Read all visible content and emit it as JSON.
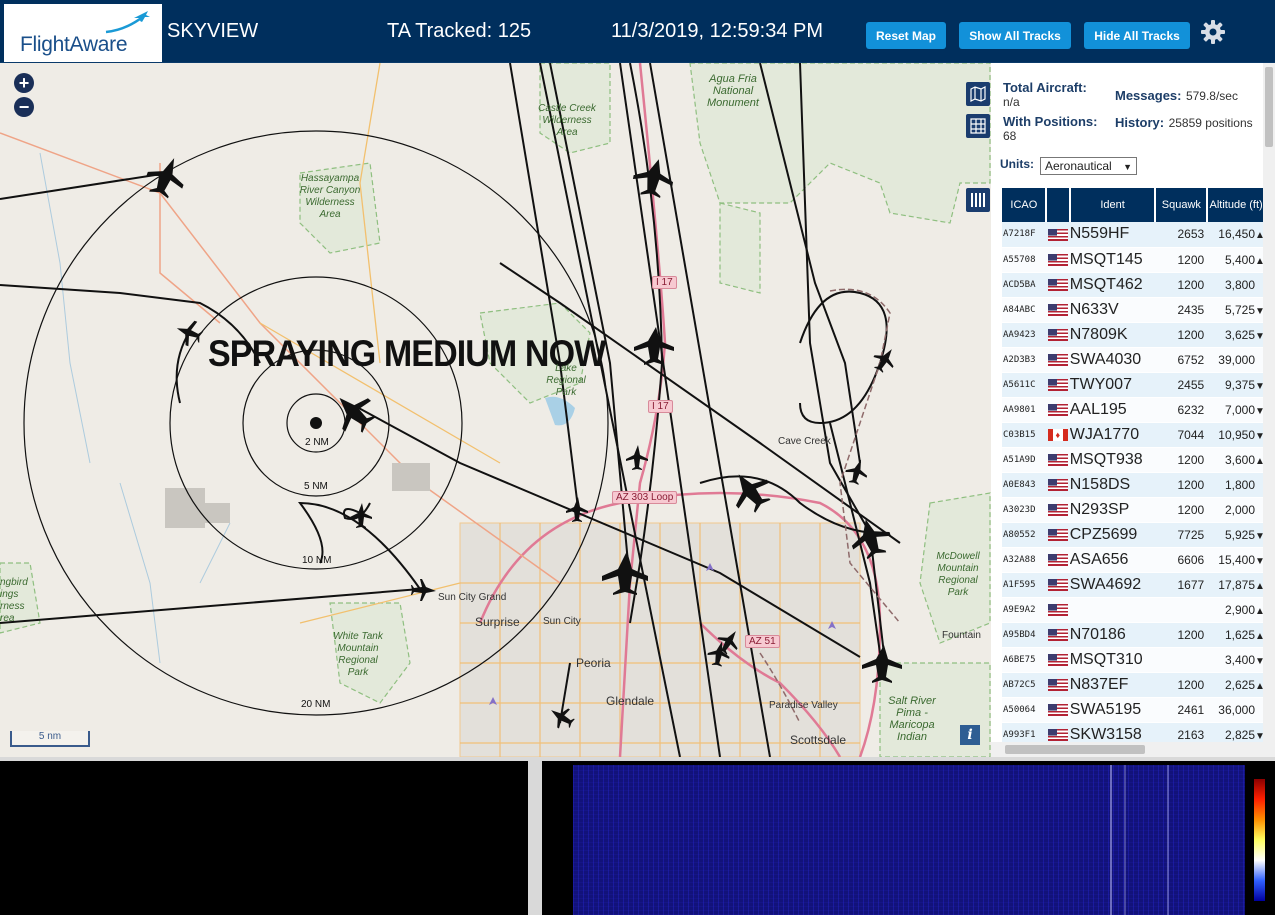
{
  "header": {
    "logo_text": "FlightAware",
    "app_title": "SKYVIEW",
    "ta_tracked": "TA Tracked: 125",
    "clock": "11/3/2019, 12:59:34 PM",
    "buttons": {
      "reset_map": "Reset Map",
      "show_all": "Show All Tracks",
      "hide_all": "Hide All Tracks"
    },
    "settings_icon": "gear-icon"
  },
  "map": {
    "overlay_text": "SPRAYING MEDIUM NOW",
    "range_labels": [
      "2 NM",
      "5 NM",
      "10 NM",
      "20 NM"
    ],
    "scale_label": "5 nm",
    "places": {
      "castle_creek": "Castle Creek Wilderness Area",
      "agua_fria": "Agua Fria National Monument",
      "hassayampa": "Hassayampa River Canyon Wilderness Area",
      "lake_regional": "Lake Regional Park",
      "cave_creek": "Cave Creek",
      "sun_city_grand": "Sun City Grand",
      "surprise": "Surprise",
      "sun_city": "Sun City",
      "peoria": "Peoria",
      "glendale": "Glendale",
      "white_tank": "White Tank Mountain Regional Park",
      "mcdowell": "McDowell Mountain Regional Park",
      "fountain": "Fountain",
      "paradise_valley": "Paradise Valley",
      "scottsdale": "Scottsdale",
      "salt_river": "Salt River Pima - Maricopa Indian",
      "hummingbird": "ngbird ings rness rea"
    },
    "road_tags": {
      "i17a": "I 17",
      "i17b": "I 17",
      "loop303": "AZ 303 Loop",
      "loop51": "AZ 51"
    }
  },
  "panel": {
    "total_aircraft_label": "Total Aircraft:",
    "total_aircraft_value": "n/a",
    "messages_label": "Messages:",
    "messages_value": "579.8/sec",
    "with_positions_label": "With Positions:",
    "with_positions_value": "68",
    "history_label": "History:",
    "history_value": "25859 positions",
    "units_label": "Units:",
    "units_value": "Aeronautical",
    "columns": [
      "ICAO",
      "",
      "Ident",
      "Squawk",
      "Altitude (ft)"
    ],
    "rows": [
      {
        "icao": "A7218F",
        "flag": "us",
        "ident": "N559HF",
        "squawk": "2653",
        "alt": "16,450",
        "trend": "▲"
      },
      {
        "icao": "A55708",
        "flag": "us",
        "ident": "MSQT145",
        "squawk": "1200",
        "alt": "5,400",
        "trend": "▲"
      },
      {
        "icao": "ACD5BA",
        "flag": "us",
        "ident": "MSQT462",
        "squawk": "1200",
        "alt": "3,800",
        "trend": ""
      },
      {
        "icao": "A84ABC",
        "flag": "us",
        "ident": "N633V",
        "squawk": "2435",
        "alt": "5,725",
        "trend": "▼"
      },
      {
        "icao": "AA9423",
        "flag": "us",
        "ident": "N7809K",
        "squawk": "1200",
        "alt": "3,625",
        "trend": "▼"
      },
      {
        "icao": "A2D3B3",
        "flag": "us",
        "ident": "SWA4030",
        "squawk": "6752",
        "alt": "39,000",
        "trend": ""
      },
      {
        "icao": "A5611C",
        "flag": "us",
        "ident": "TWY007",
        "squawk": "2455",
        "alt": "9,375",
        "trend": "▼"
      },
      {
        "icao": "AA9801",
        "flag": "us",
        "ident": "AAL195",
        "squawk": "6232",
        "alt": "7,000",
        "trend": "▼"
      },
      {
        "icao": "C03B15",
        "flag": "ca",
        "ident": "WJA1770",
        "squawk": "7044",
        "alt": "10,950",
        "trend": "▼"
      },
      {
        "icao": "A51A9D",
        "flag": "us",
        "ident": "MSQT938",
        "squawk": "1200",
        "alt": "3,600",
        "trend": "▲"
      },
      {
        "icao": "A0E843",
        "flag": "us",
        "ident": "N158DS",
        "squawk": "1200",
        "alt": "1,800",
        "trend": ""
      },
      {
        "icao": "A3023D",
        "flag": "us",
        "ident": "N293SP",
        "squawk": "1200",
        "alt": "2,000",
        "trend": ""
      },
      {
        "icao": "A80552",
        "flag": "us",
        "ident": "CPZ5699",
        "squawk": "7725",
        "alt": "5,925",
        "trend": "▼"
      },
      {
        "icao": "A32A88",
        "flag": "us",
        "ident": "ASA656",
        "squawk": "6606",
        "alt": "15,400",
        "trend": "▼"
      },
      {
        "icao": "A1F595",
        "flag": "us",
        "ident": "SWA4692",
        "squawk": "1677",
        "alt": "17,875",
        "trend": "▲"
      },
      {
        "icao": "A9E9A2",
        "flag": "us",
        "ident": "",
        "squawk": "",
        "alt": "2,900",
        "trend": "▲"
      },
      {
        "icao": "A95BD4",
        "flag": "us",
        "ident": "N70186",
        "squawk": "1200",
        "alt": "1,625",
        "trend": "▲"
      },
      {
        "icao": "A6BE75",
        "flag": "us",
        "ident": "MSQT310",
        "squawk": "",
        "alt": "3,400",
        "trend": "▼"
      },
      {
        "icao": "AB72C5",
        "flag": "us",
        "ident": "N837EF",
        "squawk": "1200",
        "alt": "2,625",
        "trend": "▲"
      },
      {
        "icao": "A50064",
        "flag": "us",
        "ident": "SWA5195",
        "squawk": "2461",
        "alt": "36,000",
        "trend": ""
      },
      {
        "icao": "A993F1",
        "flag": "us",
        "ident": "SKW3158",
        "squawk": "2163",
        "alt": "2,825",
        "trend": "▼"
      }
    ]
  },
  "colors": {
    "header_bg": "#002f5d",
    "button_bg": "#1291d9",
    "table_header": "#002f5d"
  }
}
